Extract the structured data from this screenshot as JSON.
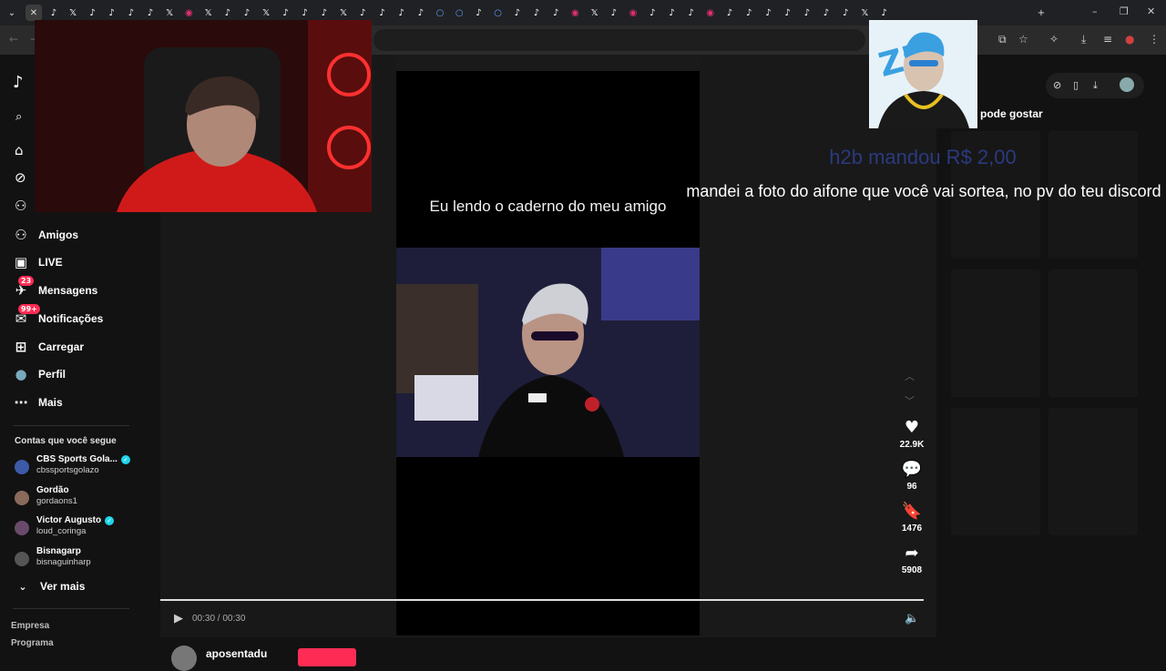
{
  "browser": {
    "tabs": [
      {
        "icon": "tiktok-icon"
      },
      {
        "icon": "x-icon"
      },
      {
        "icon": "tiktok-icon"
      },
      {
        "icon": "tiktok-icon"
      },
      {
        "icon": "tiktok-icon"
      },
      {
        "icon": "tiktok-icon"
      },
      {
        "icon": "x-icon"
      },
      {
        "icon": "instagram-icon"
      },
      {
        "icon": "x-icon"
      },
      {
        "icon": "tiktok-icon"
      },
      {
        "icon": "tiktok-icon"
      },
      {
        "icon": "x-icon"
      },
      {
        "icon": "tiktok-icon"
      },
      {
        "icon": "tiktok-icon"
      },
      {
        "icon": "tiktok-icon"
      },
      {
        "icon": "x-icon"
      },
      {
        "icon": "tiktok-icon"
      },
      {
        "icon": "tiktok-icon"
      },
      {
        "icon": "tiktok-icon"
      },
      {
        "icon": "tiktok-icon"
      },
      {
        "icon": "circle-icon"
      },
      {
        "icon": "circle-icon"
      },
      {
        "icon": "tiktok-icon"
      },
      {
        "icon": "circle-icon"
      },
      {
        "icon": "tiktok-icon"
      },
      {
        "icon": "tiktok-icon"
      },
      {
        "icon": "tiktok-icon"
      },
      {
        "icon": "instagram-icon"
      },
      {
        "icon": "x-icon"
      },
      {
        "icon": "tiktok-icon"
      },
      {
        "icon": "instagram-icon"
      },
      {
        "icon": "tiktok-icon"
      },
      {
        "icon": "tiktok-icon"
      },
      {
        "icon": "tiktok-icon"
      },
      {
        "icon": "instagram-icon"
      },
      {
        "icon": "tiktok-icon"
      },
      {
        "icon": "tiktok-icon"
      },
      {
        "icon": "tiktok-icon"
      },
      {
        "icon": "tiktok-icon"
      },
      {
        "icon": "tiktok-icon"
      },
      {
        "icon": "tiktok-icon"
      },
      {
        "icon": "tiktok-icon"
      },
      {
        "icon": "x-icon"
      },
      {
        "icon": "tiktok-icon"
      }
    ]
  },
  "sidebar": {
    "nav": [
      {
        "label": "Amigos",
        "icon": "friends-icon"
      },
      {
        "label": "LIVE",
        "icon": "live-icon"
      },
      {
        "label": "Mensagens",
        "icon": "messages-icon",
        "badge": "23"
      },
      {
        "label": "Notificações",
        "icon": "notifications-icon",
        "badge": "99+"
      },
      {
        "label": "Carregar",
        "icon": "upload-icon"
      },
      {
        "label": "Perfil",
        "icon": "profile-icon"
      },
      {
        "label": "Mais",
        "icon": "more-icon"
      }
    ],
    "following_title": "Contas que você segue",
    "accounts": [
      {
        "name": "CBS Sports Gola...",
        "handle": "cbssportsgolazo",
        "verified": true,
        "color": "#3d5aa8"
      },
      {
        "name": "Gordão",
        "handle": "gordaons1",
        "verified": false,
        "color": "#8a6a5a"
      },
      {
        "name": "Victor Augusto",
        "handle": "loud_coringa",
        "verified": true,
        "color": "#6a4a6a"
      },
      {
        "name": "Bisnagarp",
        "handle": "bisnaguinharp",
        "verified": false,
        "color": "#555555"
      }
    ],
    "see_more": "Ver mais",
    "footer": [
      "Empresa",
      "Programa"
    ]
  },
  "video": {
    "caption": "Eu lendo o caderno do meu amigo",
    "time": "00:30 / 00:30",
    "progress": 1.0,
    "author": "aposentadu"
  },
  "actions": {
    "likes": "22.9K",
    "comments": "96",
    "saves": "1476",
    "shares": "5908"
  },
  "recommended": {
    "title": "pode gostar"
  },
  "overlay": {
    "donation": "h2b mandou R$ 2,00",
    "message": "mandei a foto do aifone que você vai sortea, no pv do teu discord"
  },
  "colors": {
    "accent": "#fe2c55",
    "verified": "#20d5ec",
    "donation_text": "#2a3a80"
  }
}
